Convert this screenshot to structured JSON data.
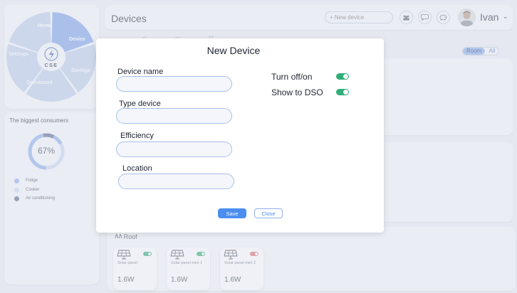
{
  "sidebar": {
    "logo_text": "CSE",
    "wheel": {
      "home": "Home",
      "device": "Device",
      "savings": "Savings",
      "dashboard": "Dashboard",
      "settings": "Settings"
    },
    "active_color": "#7fa3ea",
    "inactive_color": "#bccce9"
  },
  "consumers": {
    "title": "The biggest consumers",
    "percent": "67%",
    "percent_value": 0.67,
    "legend": [
      {
        "label": "Fridge",
        "color": "#8fb0ec"
      },
      {
        "label": "Cooker",
        "color": "#cbd8f2"
      },
      {
        "label": "Air conditioning",
        "color": "#5b6a8c"
      }
    ]
  },
  "header": {
    "title": "Devices",
    "new_device_placeholder": "+ New device",
    "icons": [
      "users-icon",
      "chat-icon",
      "pig-icon"
    ],
    "username": "Ivan"
  },
  "room_filter": {
    "tabs": [
      "Room",
      "All"
    ],
    "active": "Room"
  },
  "roof": {
    "title": "Roof",
    "devices": [
      {
        "name": "Solar panel",
        "power": "1.6W",
        "on": true
      },
      {
        "name": "Solar panel mini 1",
        "power": "1.6W",
        "on": true
      },
      {
        "name": "Solar panel mini 2",
        "power": "1.6W",
        "on": false
      }
    ]
  },
  "modal": {
    "title": "New Device",
    "fields": {
      "device_name": "Device name",
      "type_device": "Type device",
      "efficiency": "Efficiency",
      "location": "Location"
    },
    "toggles": {
      "turn_on_off": "Turn off/on",
      "show_dso": "Show to DSO"
    },
    "save_label": "Save",
    "close_label": "Close"
  },
  "colors": {
    "toggle_on": "#2fae77",
    "toggle_off": "#e06a6a",
    "accent": "#4b8ef0"
  }
}
